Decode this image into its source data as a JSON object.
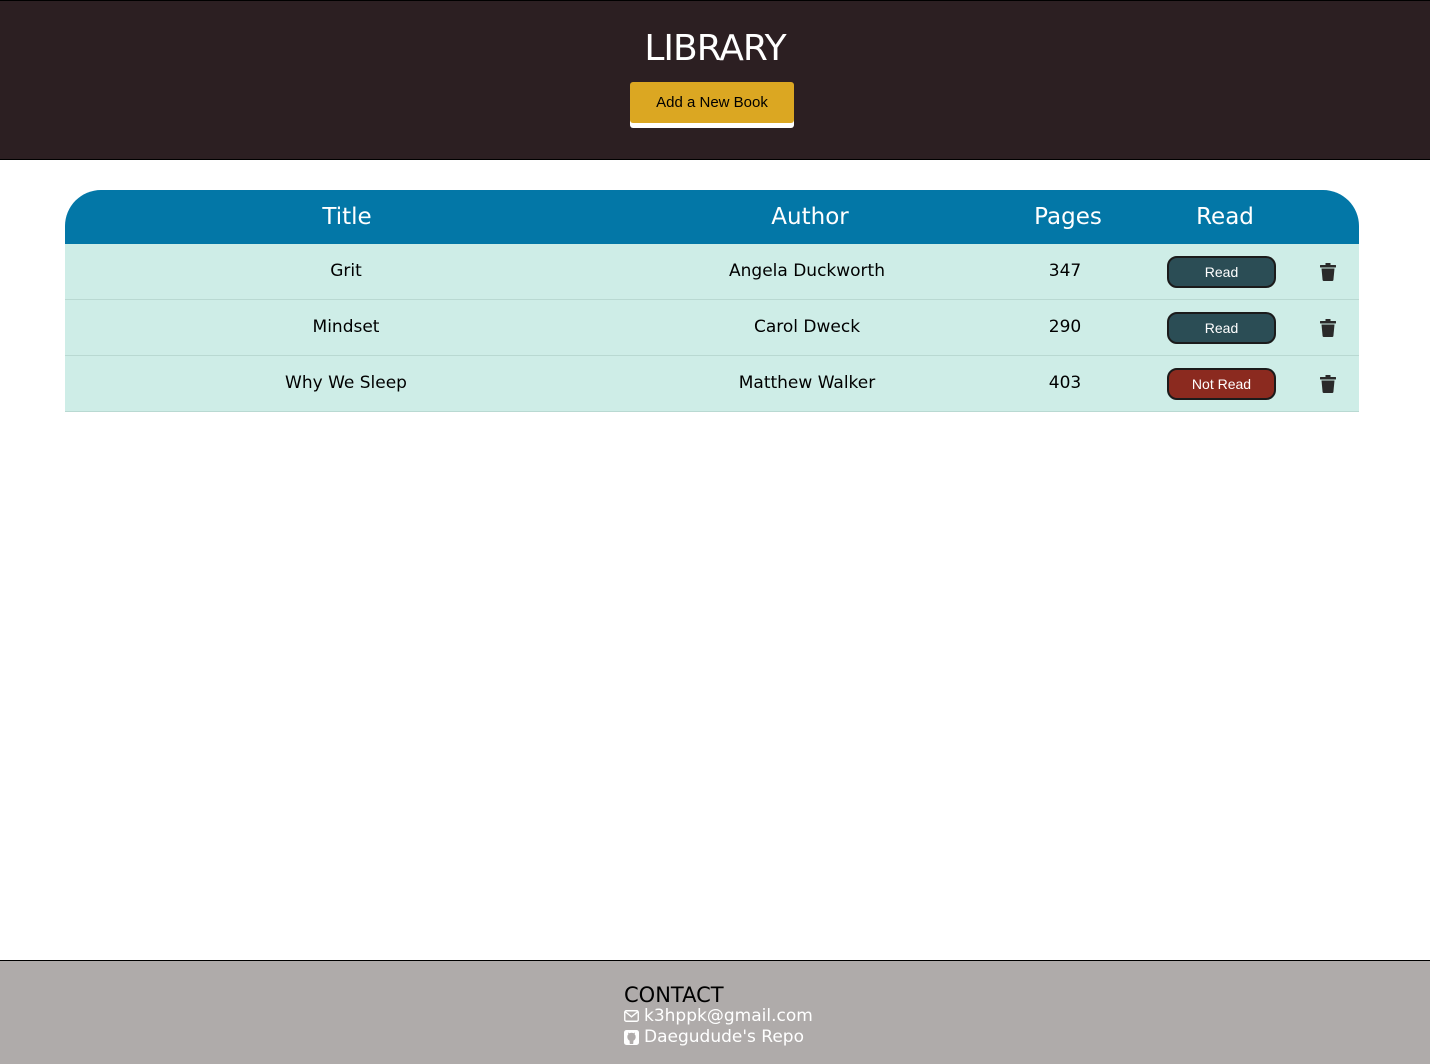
{
  "header": {
    "title": "LIBRARY",
    "add_button_label": "Add a New Book"
  },
  "table": {
    "columns": [
      "Title",
      "Author",
      "Pages",
      "Read"
    ],
    "rows": [
      {
        "title": "Grit",
        "author": "Angela Duckworth",
        "pages": "347",
        "status": "Read"
      },
      {
        "title": "Mindset",
        "author": "Carol Dweck",
        "pages": "290",
        "status": "Read"
      },
      {
        "title": "Why We Sleep",
        "author": "Matthew Walker",
        "pages": "403",
        "status": "Not Read"
      }
    ]
  },
  "footer": {
    "heading": "CONTACT",
    "email": "k3hppk@gmail.com",
    "repo": "Daegudude's Repo"
  },
  "colors": {
    "header_bg": "#2c1f22",
    "accent_button": "#dba722",
    "table_header": "#0377a7",
    "row_bg": "#ceede7",
    "status_read": "#2b4d55",
    "status_not_read": "#8b2a1f",
    "footer_bg": "#afabaa"
  },
  "icons": {
    "delete": "trash-icon",
    "email": "envelope-icon",
    "repo": "github-icon"
  }
}
